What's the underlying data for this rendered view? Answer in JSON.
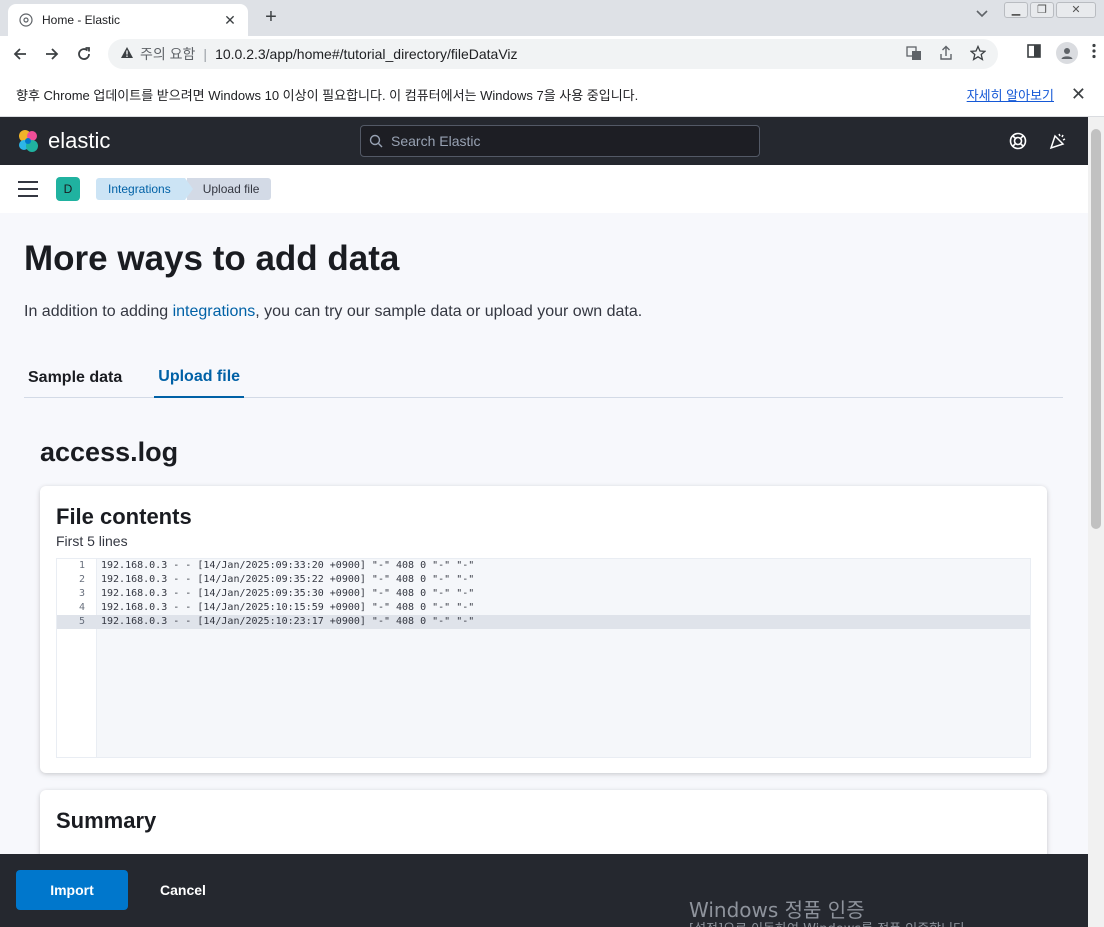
{
  "browser": {
    "tab_title": "Home - Elastic",
    "tab_close": "✕",
    "new_tab": "+",
    "security_label": "주의 요함",
    "url": "10.0.2.3/app/home#/tutorial_directory/fileDataViz"
  },
  "infobar": {
    "message": "향후 Chrome 업데이트를 받으려면 Windows 10 이상이 필요합니다. 이 컴퓨터에서는 Windows 7을 사용 중입니다.",
    "learn_more": "자세히 알아보기",
    "close": "✕"
  },
  "kibana": {
    "brand": "elastic",
    "search_placeholder": "Search Elastic",
    "space_initial": "D",
    "breadcrumbs": [
      "Integrations",
      "Upload file"
    ]
  },
  "page": {
    "title": "More ways to add data",
    "desc_prefix": "In addition to adding ",
    "desc_link": "integrations",
    "desc_suffix": ", you can try our sample data or upload your own data.",
    "tabs": [
      "Sample data",
      "Upload file"
    ],
    "selected_tab": "Upload file",
    "file_name": "access.log"
  },
  "file_contents": {
    "title": "File contents",
    "subtitle": "First 5 lines",
    "lines": [
      {
        "num": "1",
        "text": "192.168.0.3 - - [14/Jan/2025:09:33:20 +0900] \"-\" 408 0 \"-\" \"-\""
      },
      {
        "num": "2",
        "text": "192.168.0.3 - - [14/Jan/2025:09:35:22 +0900] \"-\" 408 0 \"-\" \"-\""
      },
      {
        "num": "3",
        "text": "192.168.0.3 - - [14/Jan/2025:09:35:30 +0900] \"-\" 408 0 \"-\" \"-\""
      },
      {
        "num": "4",
        "text": "192.168.0.3 - - [14/Jan/2025:10:15:59 +0900] \"-\" 408 0 \"-\" \"-\""
      },
      {
        "num": "5",
        "text": "192.168.0.3 - - [14/Jan/2025:10:23:17 +0900] \"-\" 408 0 \"-\" \"-\""
      }
    ]
  },
  "summary": {
    "title": "Summary"
  },
  "actions": {
    "import": "Import",
    "cancel": "Cancel"
  },
  "watermark": {
    "line1": "Windows 정품 인증",
    "line2": "[설정]으로 이동하여 Windows를 정품 인증합니다."
  },
  "colors": {
    "accent": "#0077cc",
    "link": "#0061a6",
    "header_bg": "#25282f"
  }
}
